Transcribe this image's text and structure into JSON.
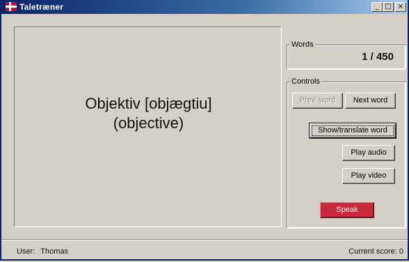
{
  "window": {
    "title": "Taletræner",
    "minimize_label": "_",
    "maximize_label": "□",
    "close_label": "×"
  },
  "word": {
    "main": "Objektiv [objægtiu]",
    "translation": "(objective)"
  },
  "words_panel": {
    "label": "Words",
    "current": 1,
    "total": 450,
    "counter_text": "1 / 450"
  },
  "controls": {
    "label": "Controls",
    "prev_label": "Prev. word",
    "next_label": "Next word",
    "show_label": "Show/translate word",
    "audio_label": "Play audio",
    "video_label": "Play video",
    "speak_label": "Speak",
    "prev_enabled": false,
    "speak_color": "#c62a3c"
  },
  "status": {
    "user_label": "User:",
    "user_name": "Thomas",
    "score_text": "Current score: 0"
  },
  "colors": {
    "titlebar_start": "#0a246a",
    "face": "#d4d0c8",
    "flag_red": "#c8102e"
  }
}
